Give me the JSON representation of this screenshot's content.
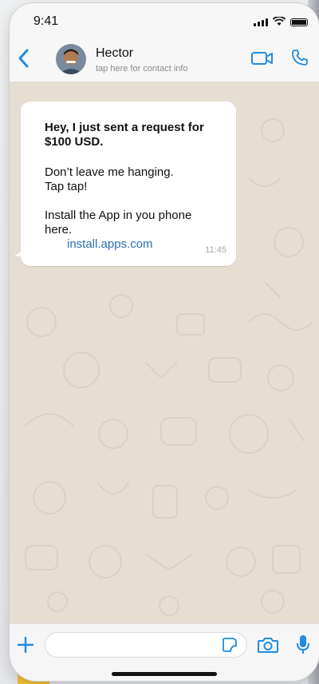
{
  "status_bar": {
    "time": "9:41"
  },
  "header": {
    "contact_name": "Hector",
    "contact_subtitle": "tap here for contact info"
  },
  "message": {
    "lines": [
      "Hey, I just sent a request for",
      "$100 USD.",
      "Don’t leave me hanging.",
      "Tap tap!",
      "Install the App in you phone",
      "here."
    ],
    "link": "install.apps.com",
    "time": "11:45"
  },
  "colors": {
    "accent": "#1f8ce0",
    "chat_background": "#e6ddd3",
    "bubble": "#ffffff",
    "link": "#2c6fb4"
  },
  "icons": {
    "back": "chevron-left-icon",
    "video": "video-call-icon",
    "call": "phone-call-icon",
    "attach": "plus-icon",
    "sticker": "sticker-icon",
    "camera": "camera-icon",
    "microphone": "microphone-icon"
  }
}
